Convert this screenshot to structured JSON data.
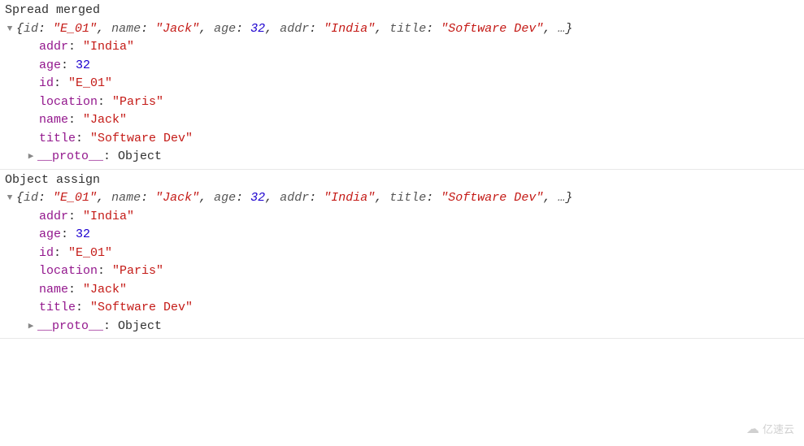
{
  "logs": [
    {
      "label": "Spread merged",
      "summary": {
        "pairs": [
          {
            "key": "id",
            "type": "string",
            "value": "\"E_01\""
          },
          {
            "key": "name",
            "type": "string",
            "value": "\"Jack\""
          },
          {
            "key": "age",
            "type": "num",
            "value": "32"
          },
          {
            "key": "addr",
            "type": "string",
            "value": "\"India\""
          },
          {
            "key": "title",
            "type": "string",
            "value": "\"Software Dev\""
          }
        ],
        "ellipsis": "…"
      },
      "props": [
        {
          "key": "addr",
          "type": "string",
          "value": "\"India\""
        },
        {
          "key": "age",
          "type": "num",
          "value": "32"
        },
        {
          "key": "id",
          "type": "string",
          "value": "\"E_01\""
        },
        {
          "key": "location",
          "type": "string",
          "value": "\"Paris\""
        },
        {
          "key": "name",
          "type": "string",
          "value": "\"Jack\""
        },
        {
          "key": "title",
          "type": "string",
          "value": "\"Software Dev\""
        }
      ],
      "proto": {
        "key": "__proto__",
        "value": "Object"
      }
    },
    {
      "label": "Object assign",
      "summary": {
        "pairs": [
          {
            "key": "id",
            "type": "string",
            "value": "\"E_01\""
          },
          {
            "key": "name",
            "type": "string",
            "value": "\"Jack\""
          },
          {
            "key": "age",
            "type": "num",
            "value": "32"
          },
          {
            "key": "addr",
            "type": "string",
            "value": "\"India\""
          },
          {
            "key": "title",
            "type": "string",
            "value": "\"Software Dev\""
          }
        ],
        "ellipsis": "…"
      },
      "props": [
        {
          "key": "addr",
          "type": "string",
          "value": "\"India\""
        },
        {
          "key": "age",
          "type": "num",
          "value": "32"
        },
        {
          "key": "id",
          "type": "string",
          "value": "\"E_01\""
        },
        {
          "key": "location",
          "type": "string",
          "value": "\"Paris\""
        },
        {
          "key": "name",
          "type": "string",
          "value": "\"Jack\""
        },
        {
          "key": "title",
          "type": "string",
          "value": "\"Software Dev\""
        }
      ],
      "proto": {
        "key": "__proto__",
        "value": "Object"
      }
    }
  ],
  "watermark": "亿速云"
}
